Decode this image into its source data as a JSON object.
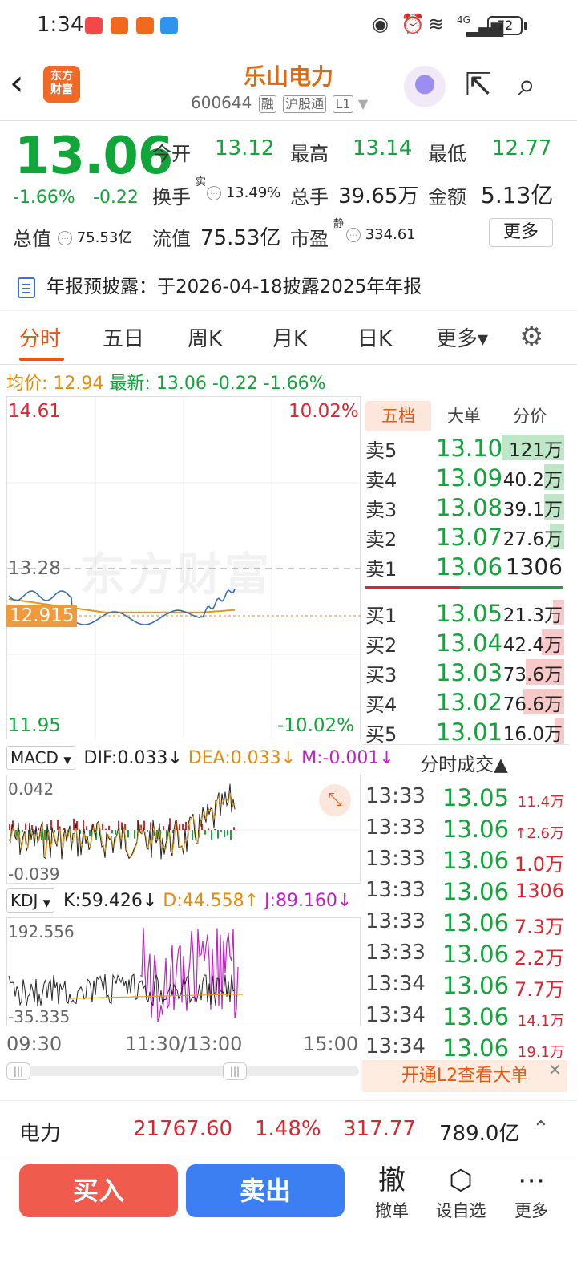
{
  "status_bar": {
    "time": "1:34",
    "battery": "72",
    "network": "4G"
  },
  "header": {
    "logo_line1": "东方",
    "logo_line2": "财富",
    "stock_name": "乐山电力",
    "stock_code": "600644",
    "tags": [
      "融",
      "沪股通",
      "L1"
    ]
  },
  "quote": {
    "price": "13.06",
    "change_pct": "-1.66%",
    "change": "-0.22",
    "open_label": "今开",
    "open": "13.12",
    "high_label": "最高",
    "high": "13.14",
    "low_label": "最低",
    "low": "12.77",
    "turnover_label": "换手",
    "turnover_sup": "实",
    "turnover": "13.49%",
    "volume_label": "总手",
    "volume": "39.65万",
    "amount_label": "金额",
    "amount": "5.13亿",
    "mcap_label": "总值",
    "mcap": "75.53亿",
    "float_label": "流值",
    "float_cap": "75.53亿",
    "pe_label": "市盈",
    "pe_sup": "静",
    "pe": "334.61",
    "more_label": "更多"
  },
  "notice": {
    "label": "年报预披露：",
    "text": "于2026-04-18披露2025年年报"
  },
  "tabs": [
    {
      "label": "分时",
      "active": true
    },
    {
      "label": "五日"
    },
    {
      "label": "周K"
    },
    {
      "label": "月K"
    },
    {
      "label": "日K"
    },
    {
      "label": "更多▾"
    }
  ],
  "avg_line": {
    "avg_label": "均价:",
    "avg": "12.94",
    "last_label": "最新:",
    "last": "13.06",
    "chg": "-0.22",
    "pct": "-1.66%"
  },
  "chart": {
    "watermark": "东方财富",
    "price_top": "14.61",
    "pct_top": "10.02%",
    "price_mid": "13.28",
    "price_cur": "12.915",
    "price_bottom": "11.95",
    "pct_bottom": "-10.02%",
    "macd": {
      "selector": "MACD",
      "dif": "DIF:0.033↓",
      "dea": "DEA:0.033↓",
      "m": "M:-0.001↓",
      "top": "0.042",
      "bottom": "-0.039"
    },
    "kdj": {
      "selector": "KDJ",
      "k": "K:59.426↓",
      "d": "D:44.558↑",
      "j": "J:89.160↓",
      "top": "192.556",
      "bottom": "-35.335"
    },
    "time_axis": [
      "09:30",
      "11:30/13:00",
      "15:00"
    ],
    "colors": {
      "price_line": "#3a6db3",
      "avg_line": "#e59a15",
      "up": "#e1232e",
      "down": "#11a53a"
    }
  },
  "order_book": {
    "tabs": [
      "五档",
      "大单",
      "分价"
    ],
    "asks": [
      {
        "label": "卖5",
        "price": "13.10",
        "vol": "121万",
        "fill": 0.34
      },
      {
        "label": "卖4",
        "price": "13.09",
        "vol": "40.2万",
        "fill": 0.11
      },
      {
        "label": "卖3",
        "price": "13.08",
        "vol": "39.1万",
        "fill": 0.11
      },
      {
        "label": "卖2",
        "price": "13.07",
        "vol": "27.6万",
        "fill": 0.08
      },
      {
        "label": "卖1",
        "price": "13.06",
        "vol": "1306",
        "fill": 0
      }
    ],
    "bids": [
      {
        "label": "买1",
        "price": "13.05",
        "vol": "21.3万",
        "fill": 0.06
      },
      {
        "label": "买2",
        "price": "13.04",
        "vol": "42.4万",
        "fill": 0.12
      },
      {
        "label": "买3",
        "price": "13.03",
        "vol": "73.6万",
        "fill": 0.21
      },
      {
        "label": "买4",
        "price": "13.02",
        "vol": "76.6万",
        "fill": 0.22
      },
      {
        "label": "买5",
        "price": "13.01",
        "vol": "16.0万",
        "fill": 0.05
      }
    ]
  },
  "trades": {
    "title": "分时成交▲",
    "rows": [
      {
        "time": "13:33",
        "price": "13.05",
        "vol": "11.4万"
      },
      {
        "time": "13:33",
        "price": "13.06",
        "vol": "↑2.6万"
      },
      {
        "time": "13:33",
        "price": "13.06",
        "vol": "1.0万"
      },
      {
        "time": "13:33",
        "price": "13.06",
        "vol": "1306"
      },
      {
        "time": "13:33",
        "price": "13.06",
        "vol": "7.3万"
      },
      {
        "time": "13:33",
        "price": "13.06",
        "vol": "2.2万"
      },
      {
        "time": "13:34",
        "price": "13.06",
        "vol": "7.7万"
      },
      {
        "time": "13:34",
        "price": "13.06",
        "vol": "14.1万"
      },
      {
        "time": "13:34",
        "price": "13.06",
        "vol": "19.1万"
      }
    ],
    "l2_banner": "开通L2查看大单"
  },
  "sector": {
    "name": "电力",
    "index": "21767.60",
    "pct": "1.48%",
    "chg": "317.77",
    "amount": "789.0亿"
  },
  "bottom_bar": {
    "buy": "买入",
    "sell": "卖出",
    "cancel_icon": "撤",
    "cancel": "撤单",
    "watch": "设自选",
    "more": "更多"
  }
}
